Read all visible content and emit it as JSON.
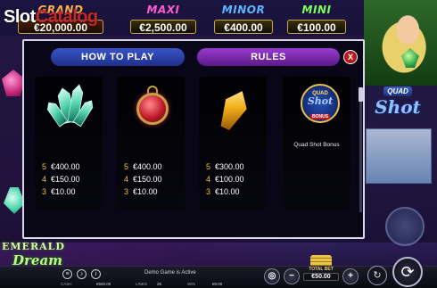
{
  "watermark": {
    "slot": "Slot",
    "catalog": "Catalog"
  },
  "jackpots": [
    {
      "name": "GRAND",
      "value": "€20,000.00"
    },
    {
      "name": "MAXI",
      "value": "€2,500.00"
    },
    {
      "name": "MINOR",
      "value": "€400.00"
    },
    {
      "name": "MINI",
      "value": "€100.00"
    }
  ],
  "side": {
    "quad_top": "QUAD",
    "quad_big": "Shot"
  },
  "logo": {
    "line1": "EMERALD",
    "line2": "Dream"
  },
  "modal": {
    "tab_how": "HOW TO PLAY",
    "tab_rules": "RULES",
    "close": "X",
    "cards": [
      {
        "symbol": "crystal-icon",
        "pays": [
          {
            "count": "5",
            "amount": "€400.00"
          },
          {
            "count": "4",
            "amount": "€150.00"
          },
          {
            "count": "3",
            "amount": "€10.00"
          }
        ]
      },
      {
        "symbol": "ruby-pendant-icon",
        "pays": [
          {
            "count": "5",
            "amount": "€400.00"
          },
          {
            "count": "4",
            "amount": "€150.00"
          },
          {
            "count": "3",
            "amount": "€10.00"
          }
        ]
      },
      {
        "symbol": "topaz-icon",
        "pays": [
          {
            "count": "5",
            "amount": "€300.00"
          },
          {
            "count": "4",
            "amount": "€100.00"
          },
          {
            "count": "3",
            "amount": "€10.00"
          }
        ]
      }
    ],
    "bonus": {
      "badge_top": "QUAD",
      "badge_mid": "Shot",
      "badge_bottom": "BONUS",
      "text": "Quad Shot Bonus"
    }
  },
  "bottom_bar": {
    "demo_text": "Demo Game is Active",
    "cash_label": "CASH",
    "cash_value": "€500.00",
    "lines_label": "LINES",
    "lines_value": "25",
    "win_label": "WIN",
    "win_value": "€0.00",
    "total_bet_label": "TOTAL BET",
    "total_bet_value": "€50.00",
    "minus": "−",
    "plus": "+"
  }
}
